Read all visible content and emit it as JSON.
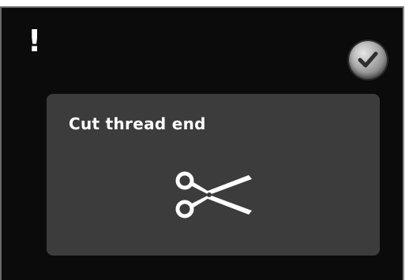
{
  "notice": {
    "alert_symbol": "!",
    "confirm_icon": "checkmark-icon",
    "message": "Cut thread end",
    "illustration_icon": "scissors-icon"
  },
  "colors": {
    "screen_background": "#0b0b0b",
    "dialog_background": "#3c3c3c",
    "text": "#ffffff",
    "button_face": "#a8a8a8",
    "check_mark": "#2f2f2f"
  }
}
